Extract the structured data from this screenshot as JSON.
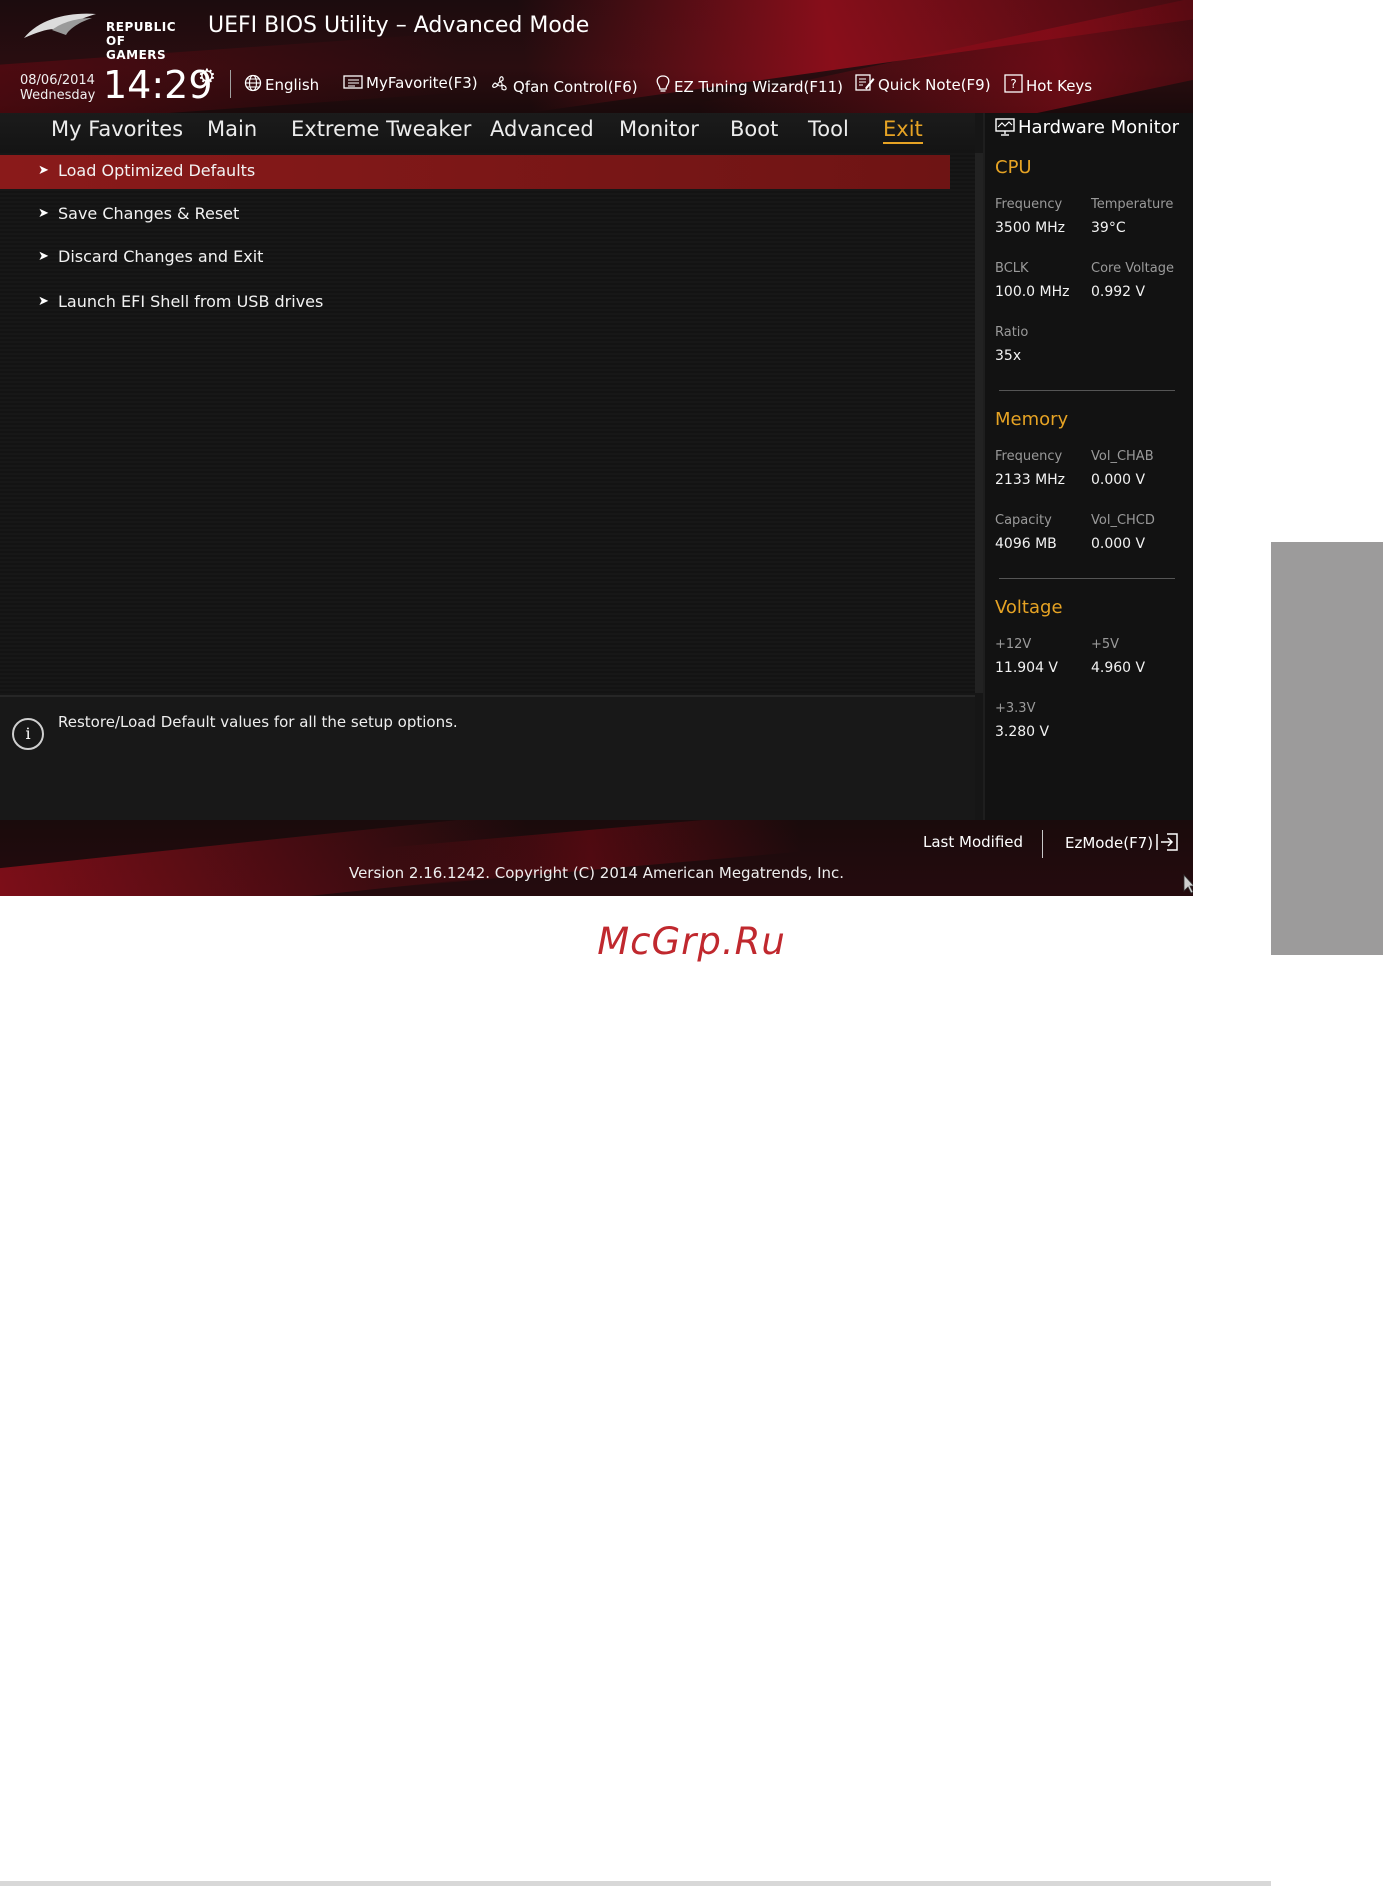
{
  "header": {
    "logo_line1": "REPUBLIC OF",
    "logo_line2": "GAMERS",
    "title": "UEFI BIOS Utility – Advanced Mode",
    "date": "08/06/2014",
    "weekday": "Wednesday",
    "time": "14:29",
    "items": [
      {
        "label": "English",
        "icon": "globe-icon"
      },
      {
        "label": "MyFavorite(F3)",
        "icon": "favorite-icon"
      },
      {
        "label": "Qfan Control(F6)",
        "icon": "fan-icon"
      },
      {
        "label": "EZ Tuning Wizard(F11)",
        "icon": "lightbulb-icon"
      },
      {
        "label": "Quick Note(F9)",
        "icon": "note-icon"
      },
      {
        "label": "Hot Keys",
        "icon": "help-icon"
      }
    ]
  },
  "tabs": [
    {
      "label": "My Favorites"
    },
    {
      "label": "Main"
    },
    {
      "label": "Extreme Tweaker"
    },
    {
      "label": "Advanced"
    },
    {
      "label": "Monitor"
    },
    {
      "label": "Boot"
    },
    {
      "label": "Tool"
    },
    {
      "label": "Exit",
      "active": true
    }
  ],
  "menu": [
    {
      "label": "Load Optimized Defaults",
      "selected": true
    },
    {
      "label": "Save Changes & Reset"
    },
    {
      "label": "Discard Changes and Exit"
    },
    {
      "label": "Launch EFI Shell from USB drives"
    }
  ],
  "help_text": "Restore/Load Default values for all the setup options.",
  "hardware_monitor": {
    "title": "Hardware Monitor",
    "cpu": {
      "heading": "CPU",
      "frequency_label": "Frequency",
      "frequency": "3500 MHz",
      "temperature_label": "Temperature",
      "temperature": "39°C",
      "bclk_label": "BCLK",
      "bclk": "100.0 MHz",
      "core_voltage_label": "Core Voltage",
      "core_voltage": "0.992 V",
      "ratio_label": "Ratio",
      "ratio": "35x"
    },
    "memory": {
      "heading": "Memory",
      "frequency_label": "Frequency",
      "frequency": "2133 MHz",
      "vol_chab_label": "Vol_CHAB",
      "vol_chab": "0.000 V",
      "capacity_label": "Capacity",
      "capacity": "4096 MB",
      "vol_chcd_label": "Vol_CHCD",
      "vol_chcd": "0.000 V"
    },
    "voltage": {
      "heading": "Voltage",
      "v12_label": "+12V",
      "v12": "11.904 V",
      "v5_label": "+5V",
      "v5": "4.960 V",
      "v33_label": "+3.3V",
      "v33": "3.280 V"
    }
  },
  "footer": {
    "last_modified": "Last Modified",
    "ezmode": "EzMode(F7)",
    "version": "Version 2.16.1242. Copyright (C) 2014 American Megatrends, Inc."
  },
  "watermark": "McGrp.Ru",
  "colors": {
    "accent": "#e6a324",
    "selection": "#8a1a1a",
    "brand_red": "#aa0f1e",
    "watermark": "#c0282e",
    "side_tab": "#9c9b9b"
  }
}
